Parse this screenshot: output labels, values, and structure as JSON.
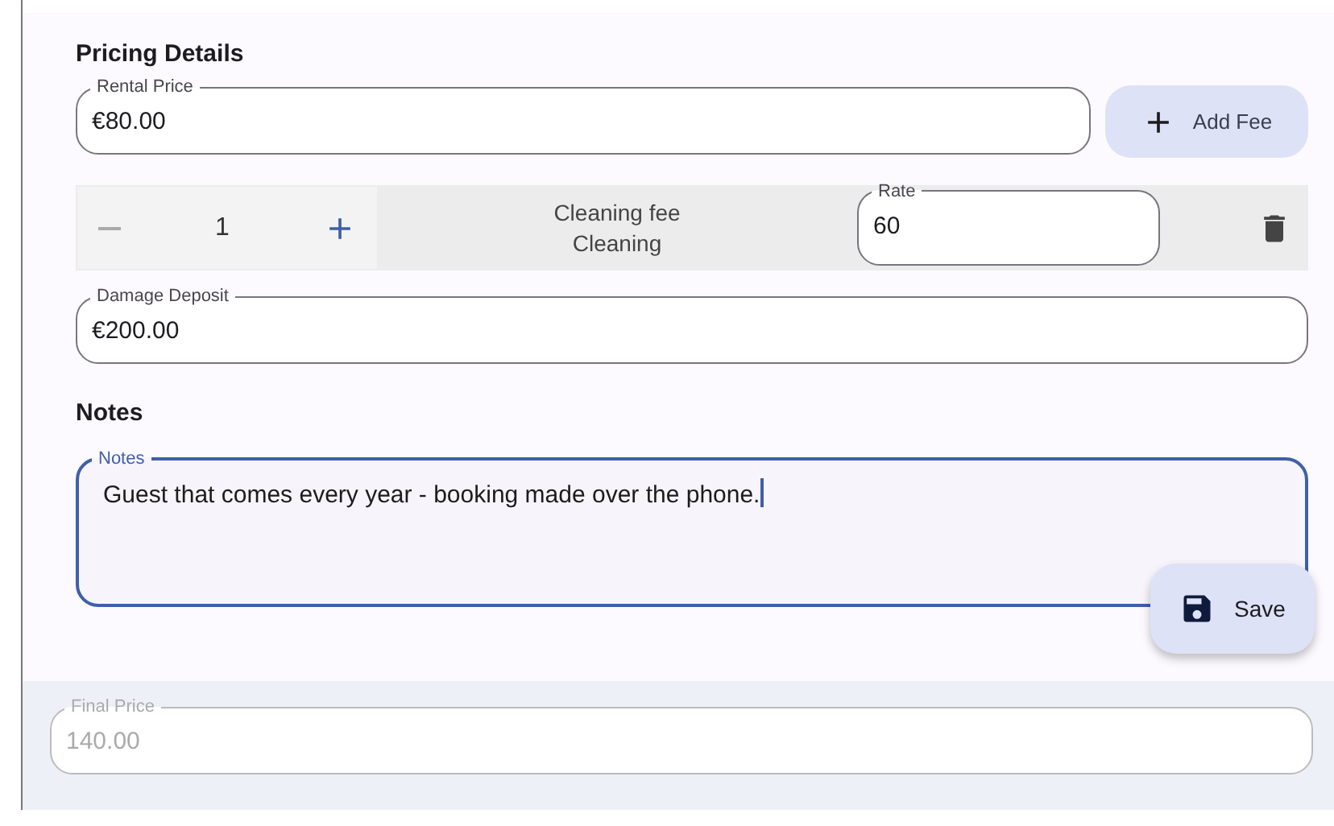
{
  "pricing_heading": "Pricing Details",
  "rental_price": {
    "label": "Rental Price",
    "value": "€80.00"
  },
  "add_fee_button": {
    "label": "Add Fee"
  },
  "fees": [
    {
      "quantity": "1",
      "decrement_disabled": true,
      "name": "Cleaning fee",
      "type": "Cleaning",
      "rate": {
        "label": "Rate",
        "value": "60"
      }
    }
  ],
  "damage_deposit": {
    "label": "Damage Deposit",
    "value": "€200.00"
  },
  "notes_heading": "Notes",
  "notes": {
    "label": "Notes",
    "value": "Guest that comes every year - booking made over the phone.",
    "focused": true
  },
  "save_button": {
    "label": "Save"
  },
  "final_price": {
    "label": "Final Price",
    "value": "140.00",
    "disabled": true
  }
}
